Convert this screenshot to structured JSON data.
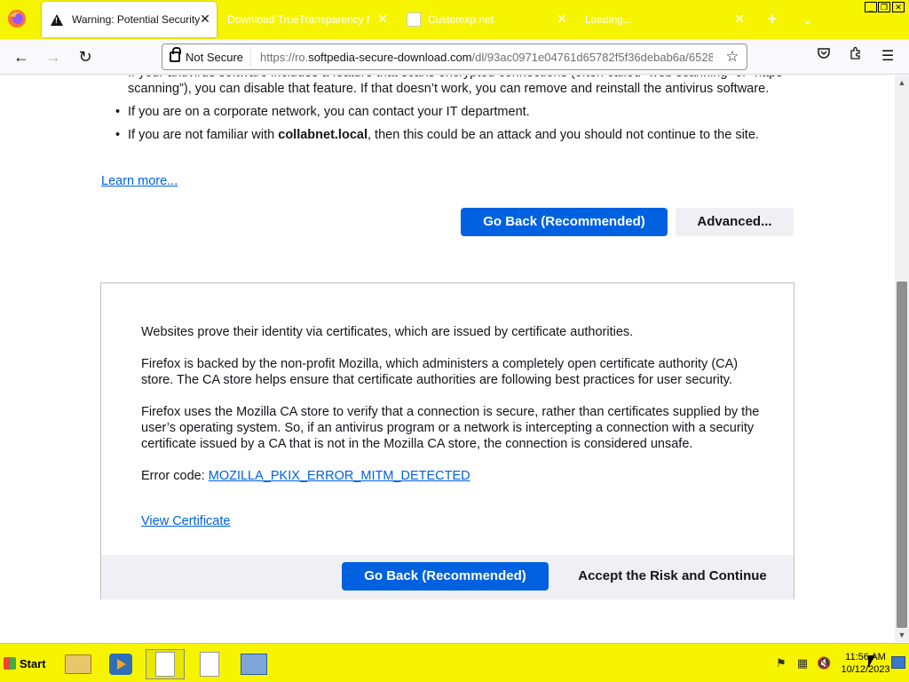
{
  "colors": {
    "chrome_yellow": "#f6f400",
    "primary_blue": "#0061e0",
    "link_blue": "#0061e0",
    "text_dark": "#15141a"
  },
  "tabs": [
    {
      "title": "Warning: Potential Security Ri",
      "icon": "warning-icon",
      "active": true
    },
    {
      "title": "Download TrueTransparency free",
      "icon": "none",
      "active": false
    },
    {
      "title": "Customxp.net",
      "icon": "page-icon",
      "active": false
    },
    {
      "title": "Loading...",
      "icon": "none",
      "active": false
    }
  ],
  "nav": {
    "security_label": "Not Secure",
    "url_prefix": "https://ro.",
    "url_host": "softpedia-secure-download.com",
    "url_path": "/dl/93ac0971e04761d65782f5f36debab6a/6528"
  },
  "content": {
    "bullet_1": "If your antivirus software includes a feature that scans encrypted connections (often called “web scanning” or “https scanning”), you can disable that feature. If that doesn’t work, you can remove and reinstall the antivirus software.",
    "bullet_2": "If you are on a corporate network, you can contact your IT department.",
    "bullet_3_pre": "If you are not familiar with ",
    "bullet_3_bold": "collabnet.local",
    "bullet_3_post": ", then this could be an attack and you should not continue to the site.",
    "learn_more": "Learn more...",
    "go_back_label": "Go Back (Recommended)",
    "advanced_label": "Advanced..."
  },
  "advanced": {
    "para_1": "Websites prove their identity via certificates, which are issued by certificate authorities.",
    "para_2": "Firefox is backed by the non-profit Mozilla, which administers a completely open certificate authority (CA) store. The CA store helps ensure that certificate authorities are following best practices for user security.",
    "para_3": "Firefox uses the Mozilla CA store to verify that a connection is secure, rather than certificates supplied by the user’s operating system. So, if an antivirus program or a network is intercepting a connection with a security certificate issued by a CA that is not in the Mozilla CA store, the connection is considered unsafe.",
    "error_code_label": "Error code: ",
    "error_code": "MOZILLA_PKIX_ERROR_MITM_DETECTED",
    "view_certificate": "View Certificate",
    "go_back_label": "Go Back (Recommended)",
    "accept_label": "Accept the Risk and Continue"
  },
  "taskbar": {
    "start_label": "Start",
    "clock_time": "11:56 AM",
    "clock_date": "10/12/2023"
  }
}
